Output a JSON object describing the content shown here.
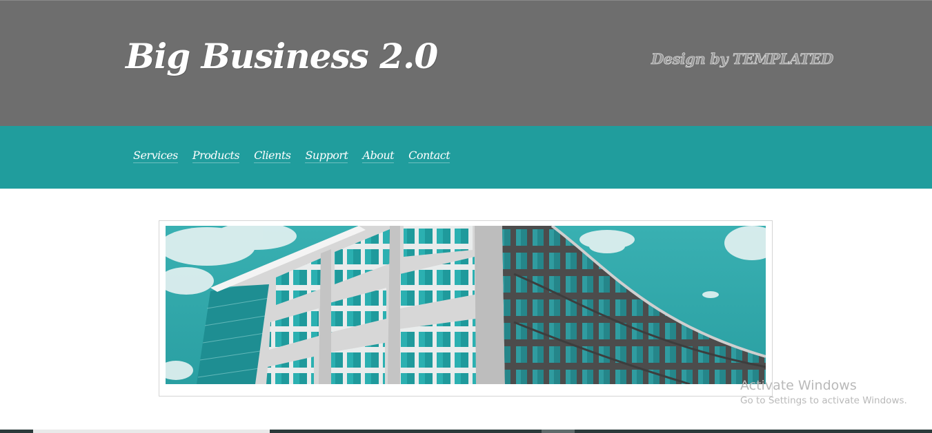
{
  "header": {
    "site_title": "Big Business 2.0",
    "credit": "Design by TEMPLATED"
  },
  "nav": {
    "items": [
      {
        "label": "Services"
      },
      {
        "label": "Products"
      },
      {
        "label": "Clients"
      },
      {
        "label": "Support"
      },
      {
        "label": "About"
      },
      {
        "label": "Contact"
      }
    ]
  },
  "banner": {
    "image": "office-building-photo"
  },
  "watermark": {
    "title": "Activate Windows",
    "subtitle": "Go to Settings to activate Windows."
  },
  "colors": {
    "header_bg": "#6e6e6e",
    "nav_bg": "#209d9d",
    "sky": "#2fa6a8"
  }
}
